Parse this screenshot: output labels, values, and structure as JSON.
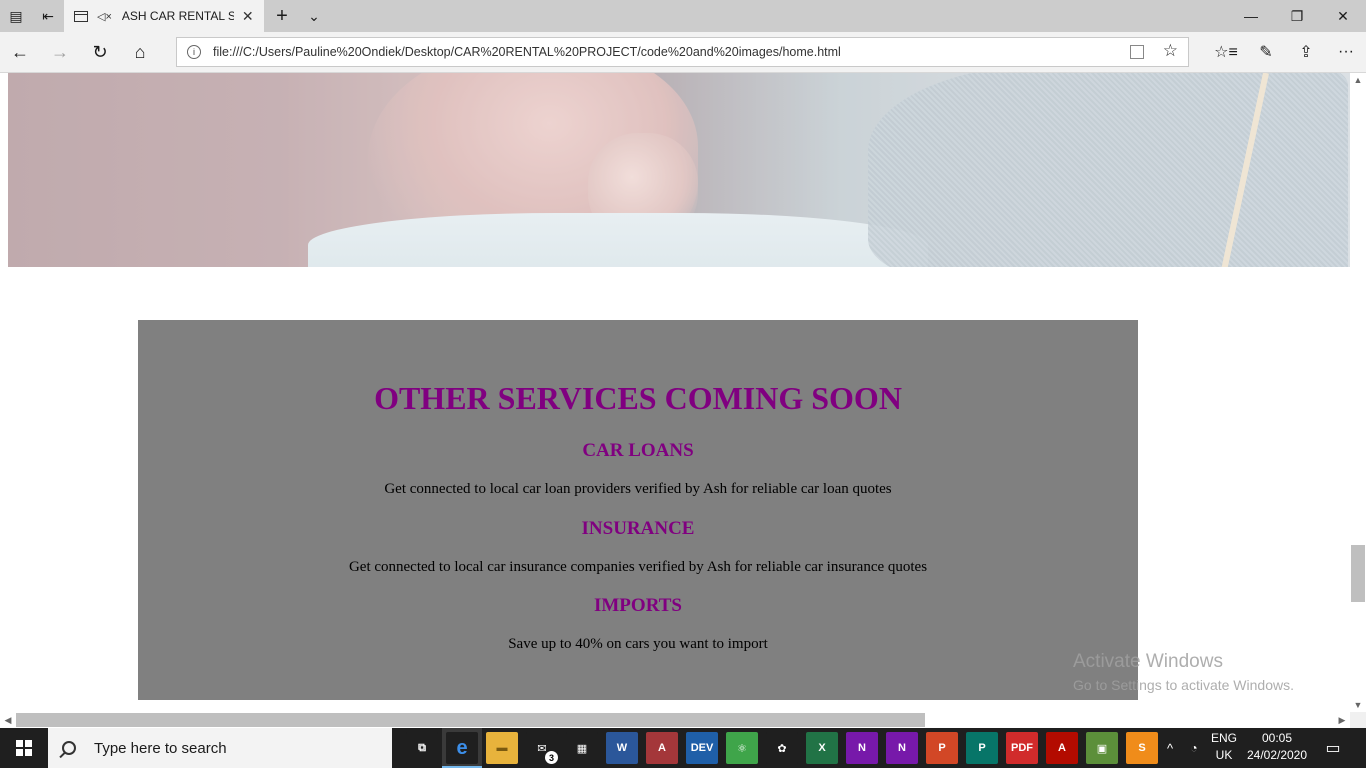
{
  "browser": {
    "tab": {
      "title": "ASH CAR RENTAL S",
      "close_glyph": "✕",
      "mute_glyph": "◁×"
    },
    "new_tab_glyph": "+",
    "tab_list_glyph": "⌄",
    "window_controls": {
      "minimize": "—",
      "restore": "❐",
      "close": "✕"
    },
    "nav": {
      "back": "←",
      "forward": "→",
      "refresh": "↻",
      "home": "⌂"
    },
    "address": {
      "url": "file:///C:/Users/Pauline%20Ondiek/Desktop/CAR%20RENTAL%20PROJECT/code%20and%20images/home.html",
      "info_glyph": "i",
      "favorite_glyph": "☆"
    },
    "tools": {
      "favorites": "☆≡",
      "notes": "✎",
      "share": "⇪",
      "more": "···"
    }
  },
  "page": {
    "services": {
      "heading": "OTHER SERVICES COMING SOON",
      "items": [
        {
          "title": "CAR LOANS",
          "text": "Get connected to local car loan providers verified by Ash for reliable car loan quotes"
        },
        {
          "title": "INSURANCE",
          "text": "Get connected to local car insurance companies verified by Ash for reliable car insurance quotes"
        },
        {
          "title": "IMPORTS",
          "text": "Save up to 40% on cars you want to import"
        }
      ]
    },
    "watermark": {
      "line1": "Activate Windows",
      "line2": "Go to Settings to activate Windows."
    }
  },
  "scroll": {
    "vertical_up": "▲",
    "vertical_down": "▼",
    "horizontal_left": "◀",
    "horizontal_right": "▶"
  },
  "taskbar": {
    "search_placeholder": "Type here to search",
    "apps": [
      {
        "name": "task-view",
        "label": "⧉",
        "color": "#1f1f1f"
      },
      {
        "name": "edge",
        "label": "e",
        "color": "#1f1f1f"
      },
      {
        "name": "file-explorer",
        "label": "▬",
        "color": "#e8b33c"
      },
      {
        "name": "mail",
        "label": "✉",
        "color": "#1f1f1f"
      },
      {
        "name": "store",
        "label": "▦",
        "color": "#1f1f1f"
      },
      {
        "name": "word",
        "label": "W",
        "color": "#2b579a"
      },
      {
        "name": "access",
        "label": "A",
        "color": "#a4373a"
      },
      {
        "name": "dev-cpp",
        "label": "DEV",
        "color": "#1f5fa8"
      },
      {
        "name": "atom",
        "label": "⚛",
        "color": "#3fa54a"
      },
      {
        "name": "gimp",
        "label": "✿",
        "color": "#1f1f1f"
      },
      {
        "name": "excel",
        "label": "X",
        "color": "#217346"
      },
      {
        "name": "onenote",
        "label": "N",
        "color": "#7719aa"
      },
      {
        "name": "onenote-2016",
        "label": "N",
        "color": "#7719aa"
      },
      {
        "name": "powerpoint",
        "label": "P",
        "color": "#d24726"
      },
      {
        "name": "publisher",
        "label": "P",
        "color": "#077568"
      },
      {
        "name": "pdf-reader",
        "label": "PDF",
        "color": "#d12b2b"
      },
      {
        "name": "acrobat",
        "label": "A",
        "color": "#b30b00"
      },
      {
        "name": "android",
        "label": "▣",
        "color": "#5c8f3a"
      },
      {
        "name": "sublime",
        "label": "S",
        "color": "#f08c1a"
      }
    ],
    "mail_badge": "3",
    "tray": {
      "chevron": "^",
      "language_top": "ENG",
      "language_bottom": "UK",
      "time": "00:05",
      "date": "24/02/2020",
      "notifications": "▭"
    }
  }
}
